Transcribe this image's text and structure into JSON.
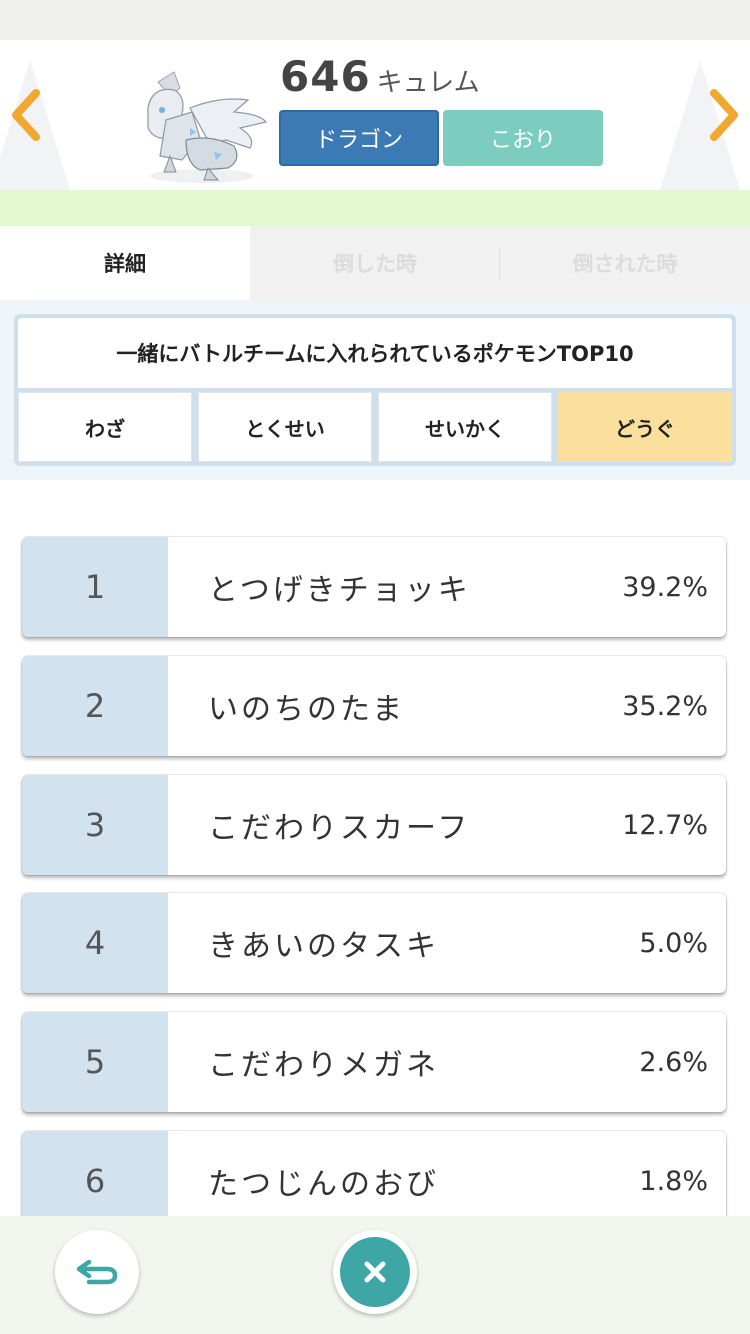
{
  "header": {
    "dex_number": "646",
    "name": "キュレム",
    "types": [
      {
        "label": "ドラゴン",
        "color": "#3c7ab5"
      },
      {
        "label": "こおり",
        "color": "#7ccdbf"
      }
    ],
    "nav": {
      "prev_icon": "chevron-left-icon",
      "next_icon": "chevron-right-icon",
      "arrow_color": "#f0a830"
    }
  },
  "tabs": [
    {
      "label": "詳細",
      "active": true
    },
    {
      "label": "倒した時",
      "active": false
    },
    {
      "label": "倒された時",
      "active": false
    }
  ],
  "ranking_card": {
    "title": "一緒にバトルチームに入れられているポケモンTOP10",
    "subtabs": [
      {
        "label": "わざ",
        "active": false
      },
      {
        "label": "とくせい",
        "active": false
      },
      {
        "label": "せいかく",
        "active": false
      },
      {
        "label": "どうぐ",
        "active": true
      }
    ],
    "active_color": "#fbdf9c"
  },
  "items": [
    {
      "rank": "1",
      "name": "とつげきチョッキ",
      "percent": "39.2%"
    },
    {
      "rank": "2",
      "name": "いのちのたま",
      "percent": "35.2%"
    },
    {
      "rank": "3",
      "name": "こだわりスカーフ",
      "percent": "12.7%"
    },
    {
      "rank": "4",
      "name": "きあいのタスキ",
      "percent": "5.0%"
    },
    {
      "rank": "5",
      "name": "こだわりメガネ",
      "percent": "2.6%"
    },
    {
      "rank": "6",
      "name": "たつじんのおび",
      "percent": "1.8%"
    }
  ],
  "bottom": {
    "back_icon": "return-arrow-icon",
    "close_icon": "close-icon",
    "accent": "#3fa6a6"
  }
}
